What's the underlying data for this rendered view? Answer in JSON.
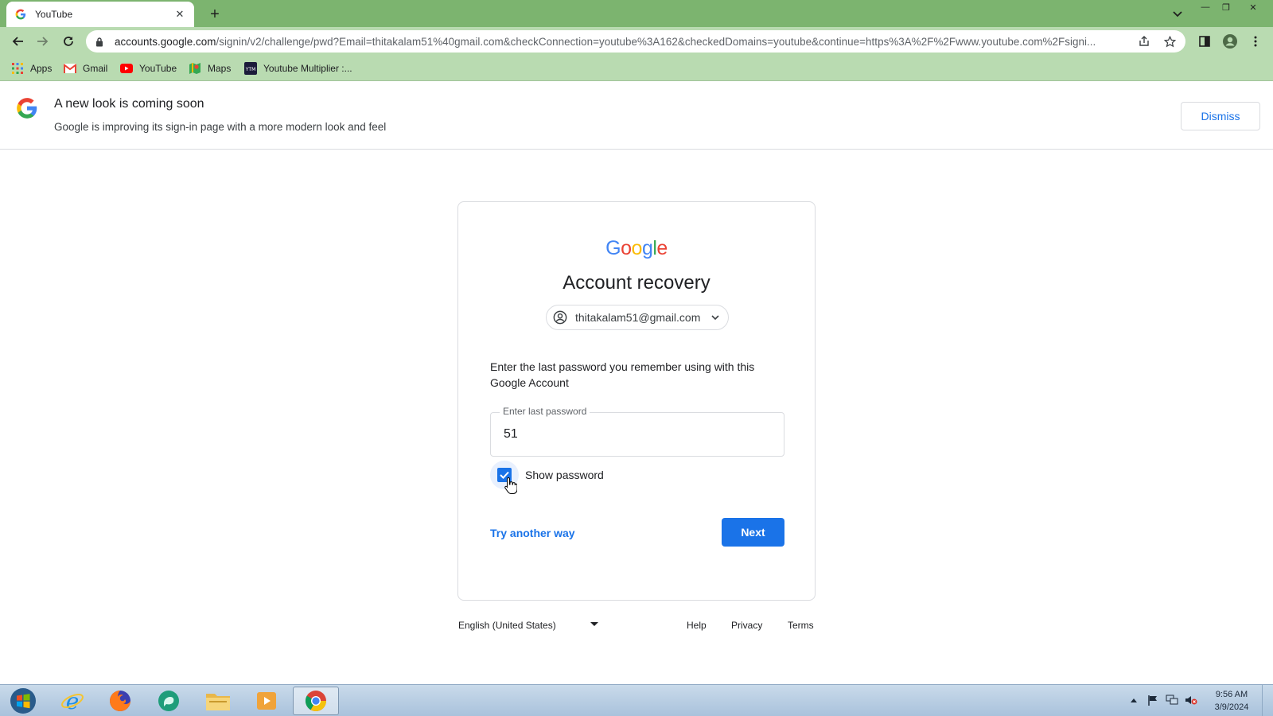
{
  "browser": {
    "tab_title": "YouTube",
    "url_host": "accounts.google.com",
    "url_rest": "/signin/v2/challenge/pwd?Email=thitakalam51%40gmail.com&checkConnection=youtube%3A162&checkedDomains=youtube&continue=https%3A%2F%2Fwww.youtube.com%2Fsigni..."
  },
  "bookmarks": [
    {
      "label": "Apps",
      "icon": "apps-grid-icon"
    },
    {
      "label": "Gmail",
      "icon": "gmail-icon"
    },
    {
      "label": "YouTube",
      "icon": "youtube-icon"
    },
    {
      "label": "Maps",
      "icon": "maps-icon"
    },
    {
      "label": "Youtube Multiplier :...",
      "icon": "ytm-icon"
    }
  ],
  "banner": {
    "title": "A new look is coming soon",
    "subtitle": "Google is improving its sign-in page with a more modern look and feel",
    "dismiss_label": "Dismiss"
  },
  "card": {
    "logo_text": "Google",
    "title": "Account recovery",
    "account_email": "thitakalam51@gmail.com",
    "instruction": "Enter the last password you remember using with this Google Account",
    "password_label": "Enter last password",
    "password_value": "51",
    "show_password_label": "Show password",
    "show_password_checked": true,
    "try_another_way": "Try another way",
    "next_label": "Next"
  },
  "footer": {
    "language": "English (United States)",
    "help": "Help",
    "privacy": "Privacy",
    "terms": "Terms"
  },
  "taskbar": {
    "time": "9:56 AM",
    "date": "3/9/2024"
  },
  "colors": {
    "accent": "#1a73e8",
    "tabstrip": "#7cb46f",
    "toolbar": "#b9dbb1"
  }
}
